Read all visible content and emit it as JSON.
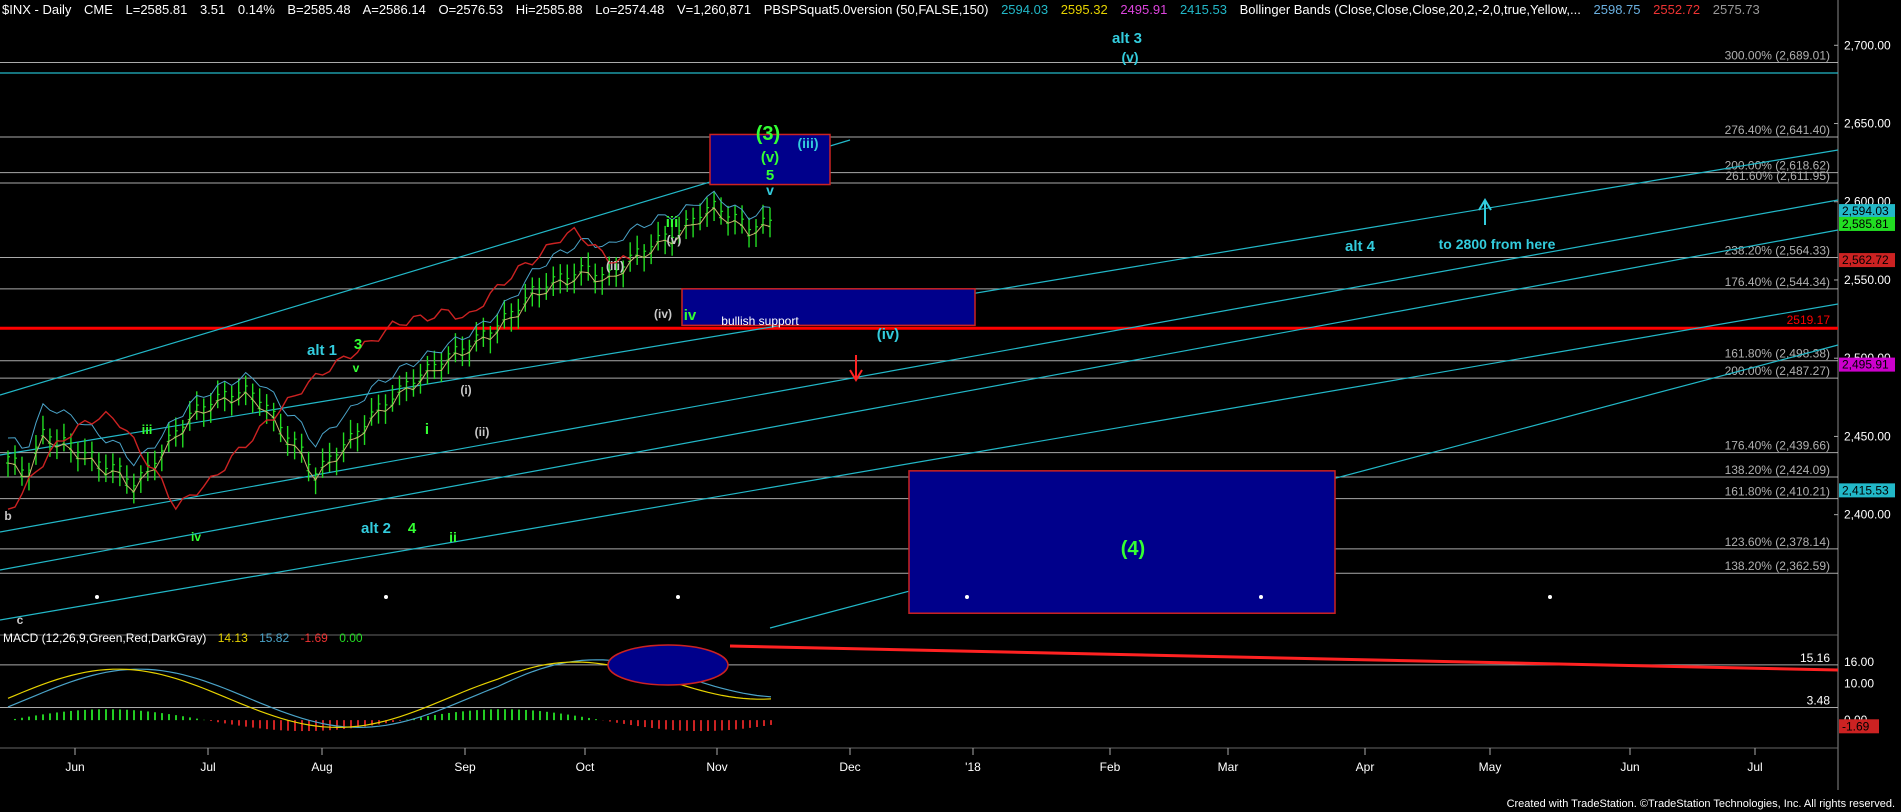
{
  "colors": {
    "background": "#000000",
    "price_bars": "#22dd22",
    "channel_lines": "#22b8c8",
    "fib_lines": "#c8c8c8",
    "support_red": "#ff0000",
    "box_fill": "#00008b",
    "box_border": "#cc2222",
    "label_green": "#33ff33",
    "label_cyan": "#33ccdd",
    "bollinger_upper": "#4aa3c8",
    "bollinger_mid": "#c8b070",
    "bollinger_lower": "#cc2222"
  },
  "header": {
    "symbol": "$INX - Daily",
    "exchange": "CME",
    "last": "L=2585.81",
    "change": "3.51",
    "change_pct": "0.14%",
    "bid": "B=2585.48",
    "ask": "A=2586.14",
    "open": "O=2576.53",
    "high": "Hi=2585.88",
    "low": "Lo=2574.48",
    "volume": "V=1,260,871",
    "indicator1": "PBSPSquat5.0version (50,FALSE,150)",
    "ind1_v1": "2594.03",
    "ind1_v2": "2595.32",
    "ind1_v3": "2495.91",
    "ind1_v4": "2415.53",
    "indicator2": "Bollinger Bands (Close,Close,Close,20,2,-2,0,true,Yellow,...",
    "bb_v1": "2598.75",
    "bb_v2": "2552.72",
    "bb_v3": "2575.73"
  },
  "macd_header": {
    "name": "MACD (12,26,9,Green,Red,DarkGray)",
    "v1": "14.13",
    "v2": "15.82",
    "v3": "-1.69",
    "v4": "0.00"
  },
  "footer": "Created with TradeStation. ©TradeStation Technologies, Inc. All rights reserved.",
  "chart_data": {
    "type": "candlestick",
    "title": "$INX - Daily",
    "ylim": [
      2325,
      2720
    ],
    "y_ticks": [
      2400,
      2450,
      2500,
      2550,
      2600,
      2650,
      2700
    ],
    "y_tick_labels": [
      "2,400.00",
      "2,450.00",
      "2,500.00",
      "2,550.00",
      "2,600.00",
      "2,650.00",
      "2,700.00"
    ],
    "x_month_labels": [
      "Jun",
      "Jul",
      "Aug",
      "Sep",
      "Oct",
      "Nov",
      "Dec",
      "'18",
      "Feb",
      "Mar",
      "Apr",
      "May",
      "Jun",
      "Jul"
    ],
    "right_axis_tags": [
      {
        "value": 2594.03,
        "label": "2,594.03",
        "color": "#22b8c8"
      },
      {
        "value": 2585.81,
        "label": "2,585.81",
        "color": "#22dd22"
      },
      {
        "value": 2562.72,
        "label": "2,562.72",
        "color": "#cc2222"
      },
      {
        "value": 2495.91,
        "label": "2,495.91",
        "color": "#cc00cc"
      },
      {
        "value": 2415.53,
        "label": "2,415.53",
        "color": "#22b8c8"
      }
    ],
    "fib_levels": [
      {
        "value": 2689.01,
        "label": "300.00% (2,689.01)"
      },
      {
        "value": 2641.4,
        "label": "276.40% (2,641.40)"
      },
      {
        "value": 2618.62,
        "label": "200.00% (2,618.62)"
      },
      {
        "value": 2611.95,
        "label": "261.60% (2,611.95)"
      },
      {
        "value": 2564.33,
        "label": "238.20% (2,564.33)"
      },
      {
        "value": 2544.34,
        "label": "176.40% (2,544.34)"
      },
      {
        "value": 2498.38,
        "label": "161.80% (2,498.38)"
      },
      {
        "value": 2487.27,
        "label": "200.00% (2,487.27)"
      },
      {
        "value": 2439.66,
        "label": "176.40% (2,439.66)"
      },
      {
        "value": 2424.09,
        "label": "138.20% (2,424.09)"
      },
      {
        "value": 2410.21,
        "label": "161.80% (2,410.21)"
      },
      {
        "value": 2378.14,
        "label": "123.60% (2,378.14)"
      },
      {
        "value": 2362.59,
        "label": "138.20% (2,362.59)"
      }
    ],
    "support_line": {
      "value": 2519.17,
      "label": "2519.17"
    },
    "boxes": [
      {
        "name": "wave-3-target",
        "y_top": 2643,
        "y_bottom": 2611,
        "label": "(iii)"
      },
      {
        "name": "bullish-support",
        "y_top": 2544.34,
        "y_bottom": 2521,
        "label": "bullish support"
      },
      {
        "name": "wave-4-target",
        "y_top": 2428,
        "y_bottom": 2337,
        "label": "(4)"
      }
    ],
    "wave_labels": [
      {
        "text": "(3)",
        "color": "#33ff33"
      },
      {
        "text": "(v)",
        "color": "#33ff33"
      },
      {
        "text": "5",
        "color": "#33ff33"
      },
      {
        "text": "v",
        "color": "#33ccdd"
      },
      {
        "text": "(iii)",
        "color": "#33ccdd"
      },
      {
        "text": "alt 3",
        "color": "#33ccdd"
      },
      {
        "text": "(v)",
        "color": "#33ccdd"
      },
      {
        "text": "iii",
        "color": "#33ff33"
      },
      {
        "text": "(v)",
        "color": "#c8c8c8"
      },
      {
        "text": "(iii)",
        "color": "#c8c8c8"
      },
      {
        "text": "(iv)",
        "color": "#c8c8c8"
      },
      {
        "text": "iv",
        "color": "#33ff33"
      },
      {
        "text": "(iv)",
        "color": "#33ccdd"
      },
      {
        "text": "alt 4",
        "color": "#33ccdd"
      },
      {
        "text": "to 2800 from here",
        "color": "#33ccdd"
      },
      {
        "text": "alt 1",
        "color": "#33ccdd"
      },
      {
        "text": "3",
        "color": "#33ff33"
      },
      {
        "text": "v",
        "color": "#33ff33"
      },
      {
        "text": "iii",
        "color": "#33ff33"
      },
      {
        "text": "iv",
        "color": "#33ff33"
      },
      {
        "text": "(i)",
        "color": "#c8c8c8"
      },
      {
        "text": "i",
        "color": "#33ff33"
      },
      {
        "text": "(ii)",
        "color": "#c8c8c8"
      },
      {
        "text": "ii",
        "color": "#33ff33"
      },
      {
        "text": "alt 2",
        "color": "#33ccdd"
      },
      {
        "text": "4",
        "color": "#33ff33"
      },
      {
        "text": "b",
        "color": "#c8c8c8"
      },
      {
        "text": "c",
        "color": "#c8c8c8"
      }
    ],
    "price_path_key": [
      2435,
      2425,
      2452,
      2445,
      2440,
      2432,
      2428,
      2418,
      2432,
      2448,
      2462,
      2470,
      2475,
      2478,
      2472,
      2455,
      2442,
      2425,
      2438,
      2448,
      2462,
      2472,
      2482,
      2490,
      2498,
      2505,
      2512,
      2520,
      2530,
      2542,
      2548,
      2552,
      2556,
      2550,
      2560,
      2568,
      2575,
      2580,
      2590,
      2596,
      2588,
      2582,
      2586
    ],
    "macd": {
      "ylim": [
        -6,
        22
      ],
      "tick_labels": [
        "16.00",
        "10.00",
        "0.00"
      ],
      "tick_values": [
        16,
        10,
        0
      ],
      "markers": [
        {
          "value": 15.16,
          "label": "15.16"
        },
        {
          "value": 3.48,
          "label": "3.48"
        },
        {
          "value": -1.69,
          "label": "-1.69"
        }
      ],
      "current_macd": 14.13,
      "current_signal": 15.82,
      "current_hist": -1.69
    }
  }
}
